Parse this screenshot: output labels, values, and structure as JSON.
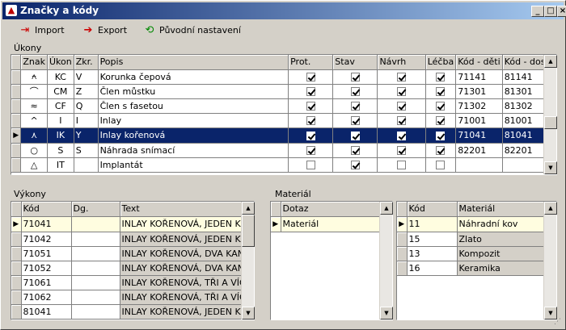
{
  "window": {
    "title": "Značky a kódy"
  },
  "toolbar": {
    "import_label": "Import",
    "export_label": "Export",
    "reset_label": "Původní nastavení"
  },
  "ukony": {
    "label": "Úkony",
    "columns": [
      "Znak",
      "Úkon",
      "Zkr.",
      "Popis",
      "Prot.",
      "Stav",
      "Návrh",
      "Léčba",
      "Kód - děti",
      "Kód - dosp."
    ],
    "rows": [
      {
        "znak": "⍲",
        "ukon": "KC",
        "zkr": "V",
        "popis": "Korunka čepová",
        "prot": true,
        "stav": true,
        "navrh": true,
        "lecba": true,
        "kod_deti": "71141",
        "kod_dosp": "81141"
      },
      {
        "znak": "⌒",
        "ukon": "CM",
        "zkr": "Z",
        "popis": "Člen můstku",
        "prot": true,
        "stav": true,
        "navrh": true,
        "lecba": true,
        "kod_deti": "71301",
        "kod_dosp": "81301"
      },
      {
        "znak": "≈",
        "ukon": "CF",
        "zkr": "Q",
        "popis": "Člen s fasetou",
        "prot": true,
        "stav": true,
        "navrh": true,
        "lecba": true,
        "kod_deti": "71302",
        "kod_dosp": "81302"
      },
      {
        "znak": "^",
        "ukon": "I",
        "zkr": "I",
        "popis": "Inlay",
        "prot": true,
        "stav": true,
        "navrh": true,
        "lecba": true,
        "kod_deti": "71001",
        "kod_dosp": "81001"
      },
      {
        "znak": "⋏",
        "ukon": "IK",
        "zkr": "Y",
        "popis": "Inlay kořenová",
        "prot": true,
        "stav": true,
        "navrh": true,
        "lecba": true,
        "kod_deti": "71041",
        "kod_dosp": "81041"
      },
      {
        "znak": "○",
        "ukon": "S",
        "zkr": "S",
        "popis": "Náhrada snímací",
        "prot": true,
        "stav": true,
        "navrh": true,
        "lecba": true,
        "kod_deti": "82201",
        "kod_dosp": "82201"
      },
      {
        "znak": "△",
        "ukon": "IT",
        "zkr": "",
        "popis": "Implantát",
        "prot": false,
        "stav": true,
        "navrh": false,
        "lecba": false,
        "kod_deti": "",
        "kod_dosp": ""
      }
    ]
  },
  "vykony": {
    "label": "Výkony",
    "columns": [
      "Kód",
      "Dg.",
      "Text"
    ],
    "rows": [
      {
        "kod": "71041",
        "dg": "",
        "text": "INLAY KOŘENOVÁ, JEDEN K"
      },
      {
        "kod": "71042",
        "dg": "",
        "text": "INLAY KOŘENOVÁ, JEDEN K"
      },
      {
        "kod": "71051",
        "dg": "",
        "text": "INLAY KOŘENOVÁ, DVA KAN"
      },
      {
        "kod": "71052",
        "dg": "",
        "text": "INLAY KOŘENOVÁ, DVA KAN"
      },
      {
        "kod": "71061",
        "dg": "",
        "text": "INLAY KOŘENOVÁ, TŘI A VÍC"
      },
      {
        "kod": "71062",
        "dg": "",
        "text": "INLAY KOŘENOVÁ, TŘI A VÍC"
      },
      {
        "kod": "81041",
        "dg": "",
        "text": "INLAY KOŘENOVÁ, JEDEN K"
      }
    ]
  },
  "material": {
    "label": "Materiál",
    "dotaz_columns": [
      "Dotaz"
    ],
    "dotaz_rows": [
      {
        "dotaz": "Materiál"
      }
    ],
    "columns": [
      "Kód",
      "Materiál"
    ],
    "rows": [
      {
        "kod": "11",
        "material": "Náhradní kov"
      },
      {
        "kod": "15",
        "material": "Zlato"
      },
      {
        "kod": "13",
        "material": "Kompozit"
      },
      {
        "kod": "16",
        "material": "Keramika"
      }
    ]
  },
  "colors": {
    "selection": "#0a246a",
    "title_start": "#0a246a",
    "title_end": "#a6caf0",
    "face": "#d4d0c8",
    "highlight_row": "#fffde0"
  }
}
